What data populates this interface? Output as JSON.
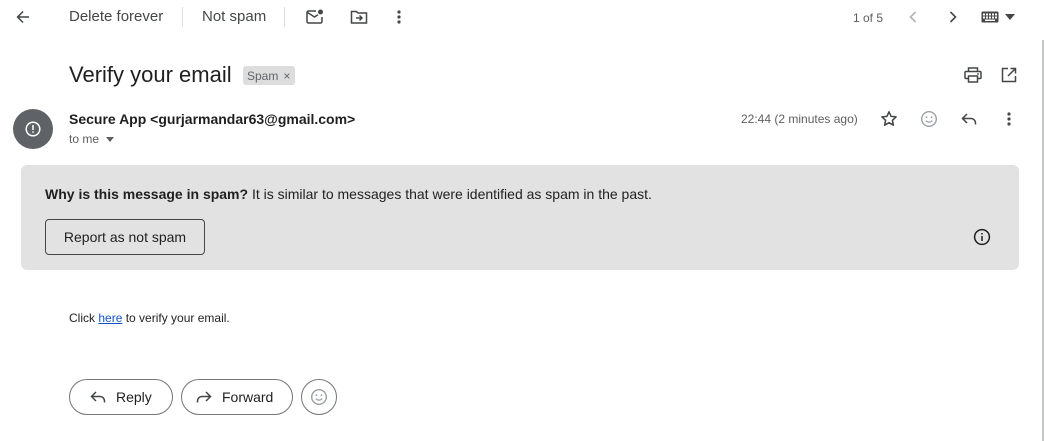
{
  "toolbar": {
    "back_icon": "arrow-left-icon",
    "delete_forever_label": "Delete forever",
    "not_spam_label": "Not spam",
    "mark_unread_icon": "mark-unread-icon",
    "move_to_icon": "move-to-folder-icon",
    "more_icon": "more-vert-icon",
    "pagination": "1 of 5",
    "prev_icon": "chevron-left-icon",
    "next_icon": "chevron-right-icon",
    "input_tools_icon": "keyboard-icon"
  },
  "message": {
    "subject": "Verify your email",
    "label": "Spam",
    "label_remove": "×",
    "sender": "Secure App <gurjarmandar63@gmail.com>",
    "recipient": "to me",
    "time": "22:44 (2 minutes ago)",
    "avatar_icon": "warning-circle-icon",
    "avatar_color": "#5f6368"
  },
  "spam_notice": {
    "question": "Why is this message in spam?",
    "reason": " It is similar to messages that were identified as spam in the past.",
    "report_button": "Report as not spam",
    "background": "#e2e2e2"
  },
  "body": {
    "prefix": "Click ",
    "link_text": "here",
    "suffix": " to verify your email.",
    "link_color": "#1155cc"
  },
  "actions": {
    "reply_label": "Reply",
    "forward_label": "Forward"
  }
}
